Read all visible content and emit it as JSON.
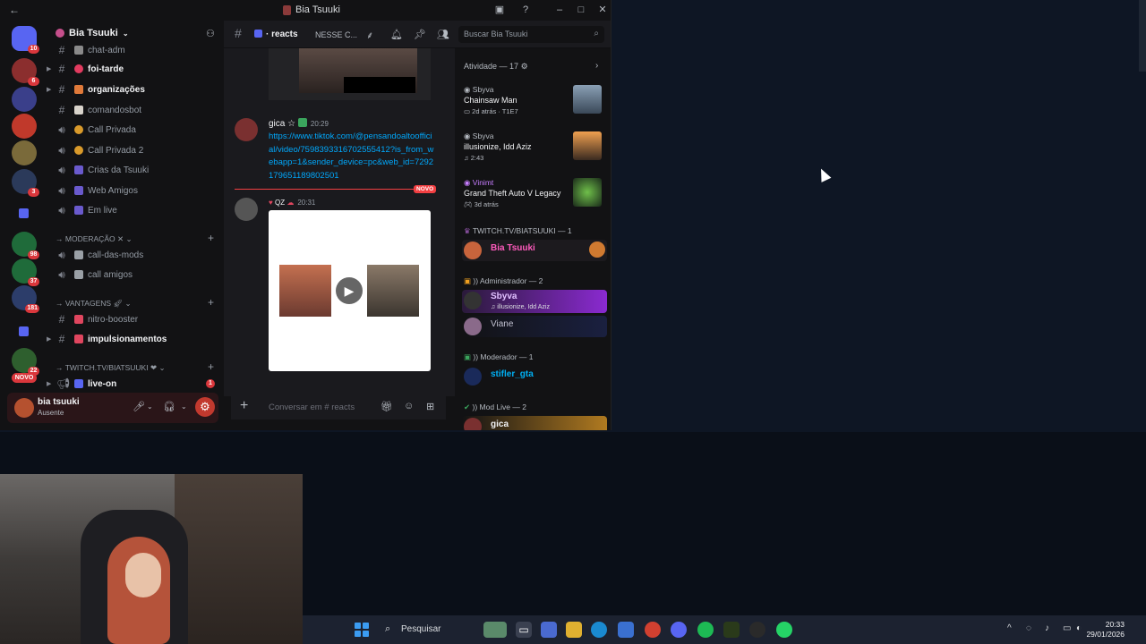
{
  "window": {
    "title": "Bia Tsuuki"
  },
  "servers": {
    "badges": [
      "10",
      "6",
      "3",
      "98",
      "37",
      "181",
      "22"
    ],
    "novo_label": "NOVO"
  },
  "sidebar": {
    "server_name": "Bia Tsuuki",
    "channels": [
      {
        "label": "chat-adm",
        "icon": "hash"
      },
      {
        "label": "foi-tarde",
        "icon": "hash",
        "bright": true
      },
      {
        "label": "organizações",
        "icon": "hash",
        "bright": true
      },
      {
        "label": "comandosbot",
        "icon": "hash"
      },
      {
        "label": "Call Privada",
        "icon": "voice"
      },
      {
        "label": "Call Privada 2",
        "icon": "voice"
      },
      {
        "label": "Crias da Tsuuki",
        "icon": "voice"
      },
      {
        "label": "Web Amigos",
        "icon": "voice"
      },
      {
        "label": "Em live",
        "icon": "voice"
      }
    ],
    "cat_moderacao": "Moderação",
    "mod_channels": [
      "call-das-mods",
      "call amigos"
    ],
    "cat_vantagens": "VANTAGENS",
    "vantagens_channels": [
      {
        "label": "nitro-booster",
        "bright": false
      },
      {
        "label": "impulsionamentos",
        "bright": true
      }
    ],
    "cat_twitch": "TWITCH.TV/BIATSUUKI",
    "twitch_channels": [
      {
        "label": "live-on",
        "badge": "1"
      }
    ]
  },
  "user": {
    "name": "bia tsuuki",
    "status": "Ausente"
  },
  "header": {
    "channel": "reacts",
    "topic": "NESSE C...",
    "search_placeholder": "Buscar Bia Tsuuki"
  },
  "chat": {
    "msg1": {
      "author": "gica",
      "time": "20:29",
      "link": "https://www.tiktok.com/@pensandoaltoofficial/video/7598393316702555412?is_from_webapp=1&sender_device=pc&web_id=7292179651189802501"
    },
    "new_label": "NOVO",
    "msg2": {
      "author": "QZ",
      "time": "20:31"
    },
    "composer_placeholder": "Conversar em # reacts"
  },
  "members": {
    "activity_header": "Atividade — 17",
    "activities": [
      {
        "who": "Sbyva",
        "what": "Chainsaw Man",
        "meta": "2d atrás · T1E7"
      },
      {
        "who": "Sbyva",
        "what": "illusionize, Idd Aziz",
        "meta": "2:43"
      },
      {
        "who": "Vinimt",
        "what": "Grand Theft Auto V Legacy",
        "meta": "3d atrás"
      }
    ],
    "cat_twitch": "TWITCH.TV/BIATSUUKI — 1",
    "twitch_member": "Bia Tsuuki",
    "cat_admin": ")) Administrador — 2",
    "admin1_name": "Sbyva",
    "admin1_sub": "illusionize, Idd Aziz",
    "admin2_name": "Viane",
    "cat_mod": ")) Moderador — 1",
    "mod1_name": "stifler_gta",
    "cat_modlive": ")) Mod Live — 2",
    "modlive1_name": "gica"
  },
  "taskbar": {
    "search_label": "Pesquisar",
    "time": "20:33",
    "date": "29/01/2026"
  },
  "colors": {
    "accent_red": "#da373c",
    "link": "#00a8fc",
    "bia_name": "#ff5bbd",
    "stifler_name": "#00b0f4"
  }
}
